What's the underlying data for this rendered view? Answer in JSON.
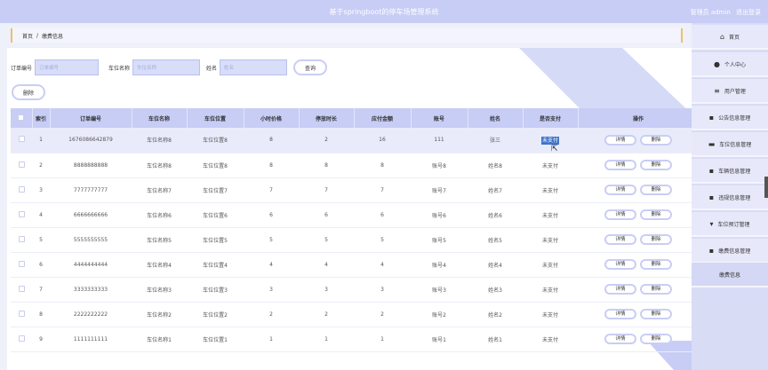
{
  "header": {
    "title": "基于springboot的停车场管理系统",
    "admin_label": "管理员 admin",
    "logout": "退出登录"
  },
  "breadcrumb": {
    "home": "首页",
    "sep": "/",
    "current": "缴费信息"
  },
  "search": {
    "order_label": "订单编号",
    "order_placeholder": "订单编号",
    "spot_label": "车位名称",
    "spot_placeholder": "车位名称",
    "name_label": "姓名",
    "name_placeholder": "姓名",
    "query_button": "查询"
  },
  "toolbar": {
    "delete_button": "删除"
  },
  "table": {
    "headers": [
      "索引",
      "订单编号",
      "车位名称",
      "车位位置",
      "小时价格",
      "停放时长",
      "应付金额",
      "账号",
      "姓名",
      "是否支付",
      "操作"
    ],
    "detail_label": "详情",
    "delete_label": "删除",
    "rows": [
      {
        "idx": "1",
        "order": "1676086642879",
        "spot": "车位名称8",
        "loc": "车位位置8",
        "price": "8",
        "dur": "2",
        "amount": "16",
        "account": "111",
        "name": "张三",
        "paid": "未支付"
      },
      {
        "idx": "2",
        "order": "8888888888",
        "spot": "车位名称8",
        "loc": "车位位置8",
        "price": "8",
        "dur": "8",
        "amount": "8",
        "account": "账号8",
        "name": "姓名8",
        "paid": "未支付"
      },
      {
        "idx": "3",
        "order": "7777777777",
        "spot": "车位名称7",
        "loc": "车位位置7",
        "price": "7",
        "dur": "7",
        "amount": "7",
        "account": "账号7",
        "name": "姓名7",
        "paid": "未支付"
      },
      {
        "idx": "4",
        "order": "6666666666",
        "spot": "车位名称6",
        "loc": "车位位置6",
        "price": "6",
        "dur": "6",
        "amount": "6",
        "account": "账号6",
        "name": "姓名6",
        "paid": "未支付"
      },
      {
        "idx": "5",
        "order": "5555555555",
        "spot": "车位名称5",
        "loc": "车位位置5",
        "price": "5",
        "dur": "5",
        "amount": "5",
        "account": "账号5",
        "name": "姓名5",
        "paid": "未支付"
      },
      {
        "idx": "6",
        "order": "4444444444",
        "spot": "车位名称4",
        "loc": "车位位置4",
        "price": "4",
        "dur": "4",
        "amount": "4",
        "account": "账号4",
        "name": "姓名4",
        "paid": "未支付"
      },
      {
        "idx": "7",
        "order": "3333333333",
        "spot": "车位名称3",
        "loc": "车位位置3",
        "price": "3",
        "dur": "3",
        "amount": "3",
        "account": "账号3",
        "name": "姓名3",
        "paid": "未支付"
      },
      {
        "idx": "8",
        "order": "2222222222",
        "spot": "车位名称2",
        "loc": "车位位置2",
        "price": "2",
        "dur": "2",
        "amount": "2",
        "account": "账号2",
        "name": "姓名2",
        "paid": "未支付"
      },
      {
        "idx": "9",
        "order": "1111111111",
        "spot": "车位名称1",
        "loc": "车位位置1",
        "price": "1",
        "dur": "1",
        "amount": "1",
        "account": "账号1",
        "name": "姓名1",
        "paid": "未支付"
      }
    ]
  },
  "sidebar": {
    "items": [
      {
        "label": "首页",
        "icon": "home-icon",
        "glyph": "⌂"
      },
      {
        "label": "个人中心",
        "icon": "person-icon",
        "glyph": "●"
      },
      {
        "label": "用户管理",
        "icon": "list-icon",
        "glyph": "≡"
      },
      {
        "label": "公告信息管理",
        "icon": "grid-icon",
        "glyph": "▪"
      },
      {
        "label": "车位信息管理",
        "icon": "briefcase-icon",
        "glyph": "▬"
      },
      {
        "label": "车辆信息管理",
        "icon": "grid-icon",
        "glyph": "▪"
      },
      {
        "label": "违规信息管理",
        "icon": "grid-icon",
        "glyph": "▪"
      },
      {
        "label": "车位预订管理",
        "icon": "car-icon",
        "glyph": "▾"
      },
      {
        "label": "缴费信息管理",
        "icon": "grid-icon",
        "glyph": "▪"
      }
    ],
    "sub_item": "缴费信息"
  },
  "colors": {
    "accent": "#c7cdf5",
    "crumb_border": "#e8c267",
    "selection": "#3e73c9"
  }
}
